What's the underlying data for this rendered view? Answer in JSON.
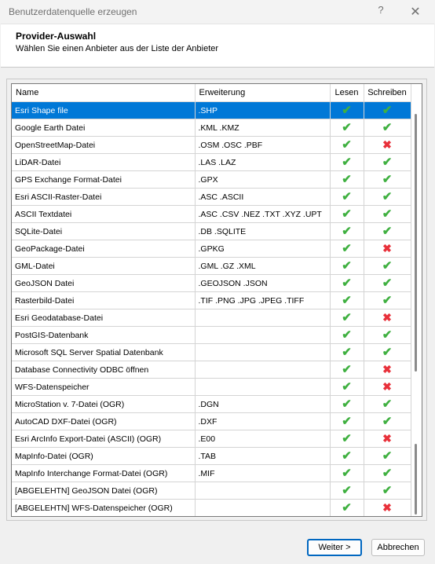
{
  "window": {
    "title": "Benutzerdatenquelle erzeugen",
    "help_glyph": "?",
    "close_glyph": "✕"
  },
  "header": {
    "title": "Provider-Auswahl",
    "subtitle": "Wählen Sie einen Anbieter aus der Liste der Anbieter"
  },
  "table": {
    "columns": [
      "Name",
      "Erweiterung",
      "Lesen",
      "Schreiben"
    ],
    "rows": [
      {
        "name": "Esri Shape file",
        "ext": ".SHP",
        "read": true,
        "write": true,
        "selected": true
      },
      {
        "name": "Google Earth Datei",
        "ext": ".KML .KMZ",
        "read": true,
        "write": true
      },
      {
        "name": "OpenStreetMap-Datei",
        "ext": ".OSM .OSC .PBF",
        "read": true,
        "write": false
      },
      {
        "name": "LiDAR-Datei",
        "ext": ".LAS .LAZ",
        "read": true,
        "write": true
      },
      {
        "name": "GPS Exchange Format-Datei",
        "ext": ".GPX",
        "read": true,
        "write": true
      },
      {
        "name": "Esri ASCII-Raster-Datei",
        "ext": ".ASC .ASCII",
        "read": true,
        "write": true
      },
      {
        "name": "ASCII Textdatei",
        "ext": ".ASC .CSV .NEZ .TXT .XYZ .UPT",
        "read": true,
        "write": true
      },
      {
        "name": "SQLite-Datei",
        "ext": ".DB .SQLITE",
        "read": true,
        "write": true
      },
      {
        "name": "GeoPackage-Datei",
        "ext": ".GPKG",
        "read": true,
        "write": false
      },
      {
        "name": "GML-Datei",
        "ext": ".GML .GZ .XML",
        "read": true,
        "write": true
      },
      {
        "name": "GeoJSON Datei",
        "ext": ".GEOJSON .JSON",
        "read": true,
        "write": true
      },
      {
        "name": "Rasterbild-Datei",
        "ext": ".TIF .PNG .JPG .JPEG .TIFF",
        "read": true,
        "write": true
      },
      {
        "name": "Esri Geodatabase-Datei",
        "ext": "",
        "read": true,
        "write": false
      },
      {
        "name": "PostGIS-Datenbank",
        "ext": "",
        "read": true,
        "write": true
      },
      {
        "name": "Microsoft SQL Server Spatial Datenbank",
        "ext": "",
        "read": true,
        "write": true
      },
      {
        "name": "Database Connectivity ODBC öffnen",
        "ext": "",
        "read": true,
        "write": false
      },
      {
        "name": "WFS-Datenspeicher",
        "ext": "",
        "read": true,
        "write": false
      },
      {
        "name": "MicroStation v. 7-Datei (OGR)",
        "ext": ".DGN",
        "read": true,
        "write": true
      },
      {
        "name": "AutoCAD DXF-Datei (OGR)",
        "ext": ".DXF",
        "read": true,
        "write": true
      },
      {
        "name": "Esri ArcInfo Export-Datei (ASCII) (OGR)",
        "ext": ".E00",
        "read": true,
        "write": false
      },
      {
        "name": "MapInfo-Datei (OGR)",
        "ext": ".TAB",
        "read": true,
        "write": true
      },
      {
        "name": "MapInfo Interchange Format-Datei (OGR)",
        "ext": ".MIF",
        "read": true,
        "write": true
      },
      {
        "name": "[ABGELEHTN] GeoJSON Datei (OGR)",
        "ext": "",
        "read": true,
        "write": true
      },
      {
        "name": "[ABGELEHTN] WFS-Datenspeicher (OGR)",
        "ext": "",
        "read": true,
        "write": false
      }
    ]
  },
  "footer": {
    "next_label": "Weiter >",
    "cancel_label": "Abbrechen"
  },
  "colors": {
    "selection": "#0078d7",
    "check": "#3fb040",
    "cross": "#e8303a"
  },
  "icons": {
    "yes": "check-icon",
    "no": "cross-icon"
  }
}
